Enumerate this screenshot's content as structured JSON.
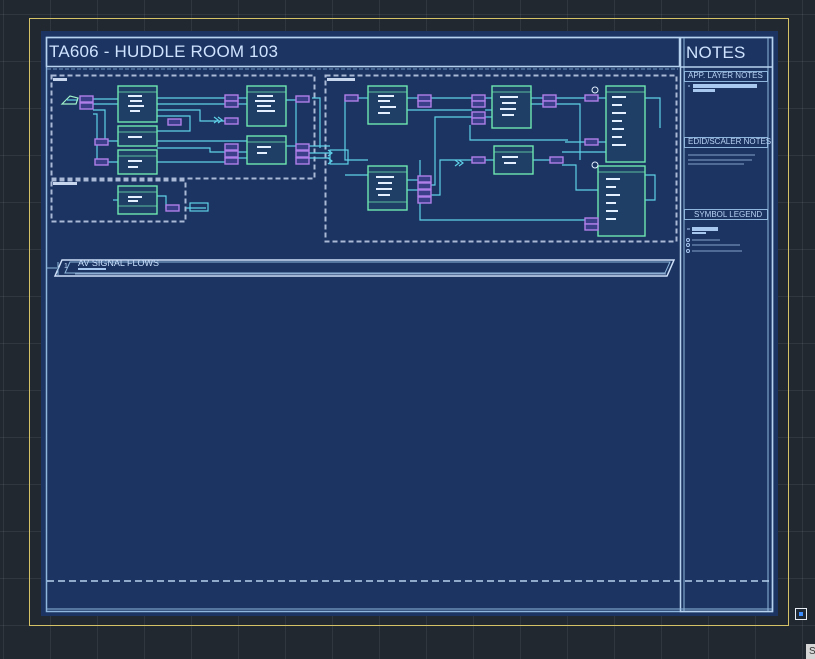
{
  "sheet": {
    "title": "TA606 - HUDDLE ROOM 103",
    "notes_title": "NOTES",
    "notes_sections": {
      "app_layer": "APP. LAYER NOTES",
      "edid_scaler": "EDID/SCALER NOTES",
      "symbol_legend": "SYMBOL LEGEND"
    },
    "signal_flows_title": "AV SIGNAL FLOWS",
    "signal_flows_index": "1"
  },
  "statusbar": {
    "tab_label": "S"
  },
  "colors": {
    "sheet_bg": "#1b3461",
    "frame": "#8fb7dd",
    "device": "#6ee7b0",
    "connector": "#b07fe8",
    "wire": "#5fd0e8",
    "outer_border": "#d6c266"
  }
}
